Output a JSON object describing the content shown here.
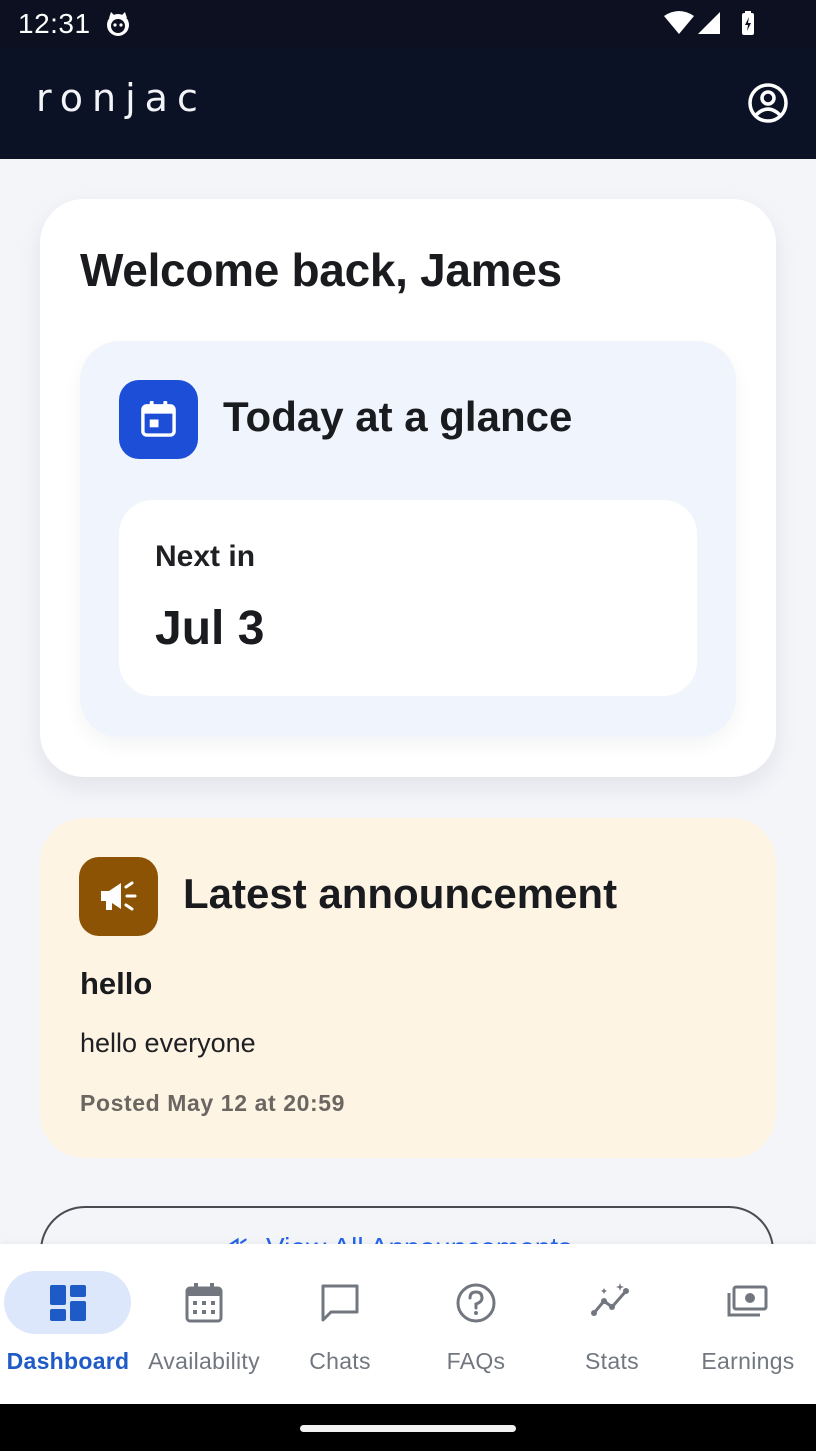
{
  "status_bar": {
    "time": "12:31",
    "icons": [
      "cat-notification-icon",
      "wifi-icon",
      "cell-signal-icon",
      "battery-charging-icon"
    ]
  },
  "app_bar": {
    "logo": "ronjac",
    "account_icon": "account-circle-icon"
  },
  "welcome": {
    "title": "Welcome back, James"
  },
  "today": {
    "icon": "calendar-icon",
    "title": "Today at a glance",
    "next_label": "Next in",
    "next_value": "Jul 3"
  },
  "announcement": {
    "icon": "megaphone-icon",
    "heading": "Latest announcement",
    "title": "hello",
    "body": "hello everyone",
    "posted": "Posted May 12 at 20:59"
  },
  "view_all": {
    "label": "View All Announcements",
    "icon": "megaphone-icon"
  },
  "bottom_nav": {
    "items": [
      {
        "label": "Dashboard",
        "icon": "dashboard-icon",
        "active": true
      },
      {
        "label": "Availability",
        "icon": "calendar-grid-icon",
        "active": false
      },
      {
        "label": "Chats",
        "icon": "chat-bubble-icon",
        "active": false
      },
      {
        "label": "FAQs",
        "icon": "help-circle-icon",
        "active": false
      },
      {
        "label": "Stats",
        "icon": "insights-icon",
        "active": false
      },
      {
        "label": "Earnings",
        "icon": "payments-icon",
        "active": false
      }
    ]
  },
  "colors": {
    "app_bar": "#0c1226",
    "primary": "#1d4ed8",
    "active_nav": "#1e5bc6",
    "announcement_bg": "#fdf4e4",
    "announcement_icon": "#8c5304"
  }
}
